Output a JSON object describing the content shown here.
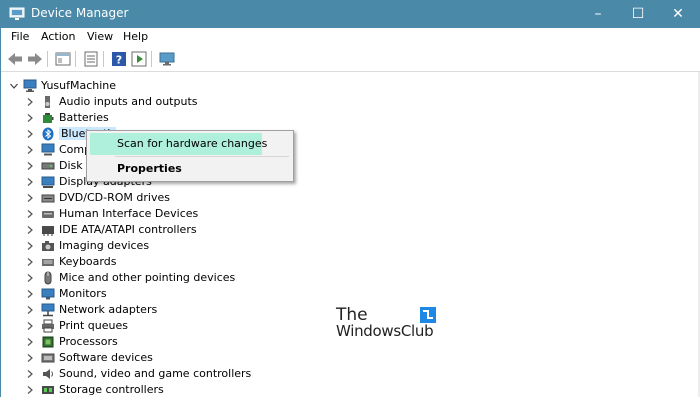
{
  "window": {
    "title": "Device Manager",
    "title_bar_color": "#4a8aa8",
    "controls": {
      "minimize": "–",
      "maximize": "☐",
      "close": "✕"
    }
  },
  "menu": {
    "items": [
      "File",
      "Action",
      "View",
      "Help"
    ]
  },
  "toolbar": {
    "buttons": [
      "back-arrow-icon",
      "forward-arrow-icon",
      "show-hide-console-tree-icon",
      "properties-icon",
      "help-icon",
      "run-icon",
      "monitor-scan-icon"
    ]
  },
  "tree": {
    "root": {
      "label": "YusufMachine",
      "expanded": true
    },
    "items": [
      {
        "label": "Audio inputs and outputs",
        "icon": "speaker-icon"
      },
      {
        "label": "Batteries",
        "icon": "battery-icon"
      },
      {
        "label": "Bluetooth",
        "icon": "bluetooth-icon"
      },
      {
        "label": "Computer",
        "icon": "computer-icon"
      },
      {
        "label": "Disk drives",
        "icon": "disk-drive-icon"
      },
      {
        "label": "Display adapters",
        "icon": "display-adapter-icon"
      },
      {
        "label": "DVD/CD-ROM drives",
        "icon": "dvd-drive-icon"
      },
      {
        "label": "Human Interface Devices",
        "icon": "hid-icon"
      },
      {
        "label": "IDE ATA/ATAPI controllers",
        "icon": "ide-controller-icon"
      },
      {
        "label": "Imaging devices",
        "icon": "camera-icon"
      },
      {
        "label": "Keyboards",
        "icon": "keyboard-icon"
      },
      {
        "label": "Mice and other pointing devices",
        "icon": "mouse-icon"
      },
      {
        "label": "Monitors",
        "icon": "monitor-icon"
      },
      {
        "label": "Network adapters",
        "icon": "network-adapter-icon"
      },
      {
        "label": "Print queues",
        "icon": "printer-icon"
      },
      {
        "label": "Processors",
        "icon": "processor-icon"
      },
      {
        "label": "Software devices",
        "icon": "software-device-icon"
      },
      {
        "label": "Sound, video and game controllers",
        "icon": "sound-icon"
      },
      {
        "label": "Storage controllers",
        "icon": "storage-controller-icon"
      }
    ]
  },
  "context_menu": {
    "items": [
      {
        "label": "Scan for hardware changes",
        "highlighted": true
      },
      {
        "label": "Properties",
        "bold": true
      }
    ],
    "highlight_color": "#aef0dc"
  },
  "watermark": {
    "line1": "The",
    "line2": "WindowsClub"
  }
}
